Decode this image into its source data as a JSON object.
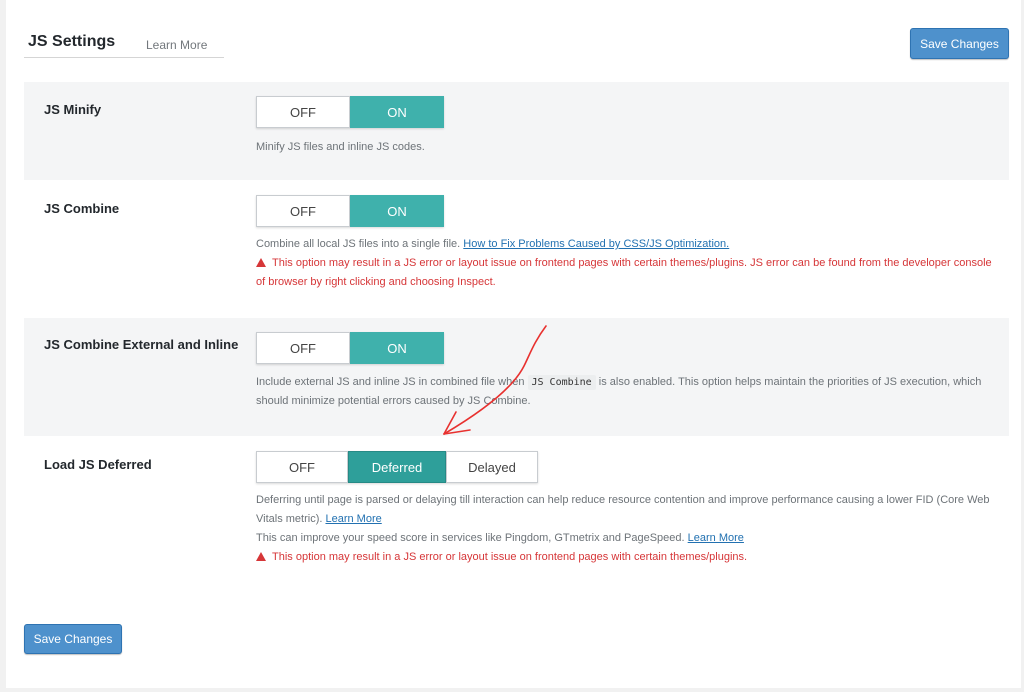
{
  "header": {
    "title": "JS Settings",
    "learn_more": "Learn More"
  },
  "buttons": {
    "save_top": "Save Changes",
    "save_bottom": "Save Changes"
  },
  "colors": {
    "accent": "#3fb1ac",
    "primary": "#4e91cc",
    "warning": "#d63638"
  },
  "rows": {
    "minify": {
      "label": "JS Minify",
      "options": [
        "OFF",
        "ON"
      ],
      "selected": "ON",
      "desc": "Minify JS files and inline JS codes."
    },
    "combine": {
      "label": "JS Combine",
      "options": [
        "OFF",
        "ON"
      ],
      "selected": "ON",
      "desc": "Combine all local JS files into a single file.",
      "link": "How to Fix Problems Caused by CSS/JS Optimization.",
      "warn": "This option may result in a JS error or layout issue on frontend pages with certain themes/plugins. JS error can be found from the developer console of browser by right clicking and choosing Inspect."
    },
    "combine_ext": {
      "label": "JS Combine External and Inline",
      "options": [
        "OFF",
        "ON"
      ],
      "selected": "ON",
      "desc_a": "Include external JS and inline JS in combined file when",
      "code": "JS Combine",
      "desc_b": "is also enabled. This option helps maintain the priorities of JS execution, which should minimize potential errors caused by JS Combine."
    },
    "deferred": {
      "label": "Load JS Deferred",
      "options": [
        "OFF",
        "Deferred",
        "Delayed"
      ],
      "selected": "Deferred",
      "desc_a": "Deferring until page is parsed or delaying till interaction can help reduce resource contention and improve performance causing a lower FID (Core Web Vitals metric).",
      "link_a": "Learn More",
      "desc_b": "This can improve your speed score in services like Pingdom, GTmetrix and PageSpeed.",
      "link_b": "Learn More",
      "warn": "This option may result in a JS error or layout issue on frontend pages with certain themes/plugins."
    }
  }
}
